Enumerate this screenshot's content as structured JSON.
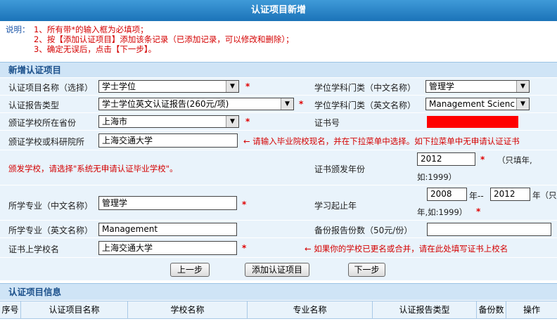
{
  "title": "认证项目新增",
  "notice": {
    "label": "说明：",
    "line1": "1、所有带*的输入框为必填项；",
    "line2": "2、按【添加认证项目】添加该条记录（已添加记录，可以修改和删除）；",
    "line3": "3、确定无误后，点击【下一步】。"
  },
  "section_new": "新增认证项目",
  "form": {
    "project_name_label": "认证项目名称（选择）",
    "project_name_value": "学士学位",
    "report_type_label": "认证报告类型",
    "report_type_value": "学士学位英文认证报告(260元/项)",
    "province_label": "颁证学校所在省份",
    "province_value": "上海市",
    "school_label": "颁证学校或科研院所",
    "school_value": "上海交通大学",
    "school_hint": "← 请输入毕业院校现名，并在下拉菜单中选择。如下拉菜单中无申请认证证书",
    "school_hint2": "颁发学校，请选择\"系统无申请认证毕业学校\"。",
    "category_cn_label": "学位学科门类（中文名称）",
    "category_cn_value": "管理学",
    "category_en_label": "学位学科门类（英文名称）",
    "category_en_value": "Management Scienc",
    "cert_no_label": "证书号",
    "issue_year_label": "证书颁发年份",
    "issue_year_value": "2012",
    "issue_year_hint": "（只填年,",
    "issue_year_hint2": "如:1999）",
    "major_cn_label": "所学专业（中文名称）",
    "major_cn_value": "管理学",
    "study_years_label": "学习起止年",
    "study_start_value": "2008",
    "study_sep": "年--",
    "study_end_value": "2012",
    "study_hint": "年（只填",
    "study_hint2": "年,如:1999）",
    "major_en_label": "所学专业（英文名称）",
    "major_en_value": "Management",
    "copies_label": "备份报告份数（50元/份）",
    "copies_value": "",
    "cert_school_label": "证书上学校名",
    "cert_school_value": "上海交通大学",
    "cert_school_hint": "← 如果你的学校已更名或合并，请在此处填写证书上校名",
    "star": "*"
  },
  "buttons": {
    "prev": "上一步",
    "add": "添加认证项目",
    "next": "下一步"
  },
  "section_info": "认证项目信息",
  "table": {
    "columns": [
      "序号",
      "认证项目名称",
      "学校名称",
      "专业名称",
      "认证报告类型",
      "备份数",
      "操作"
    ]
  },
  "colors": {
    "accent": "#1b73b8",
    "required": "#e00000",
    "redacted": "#ff0000"
  }
}
